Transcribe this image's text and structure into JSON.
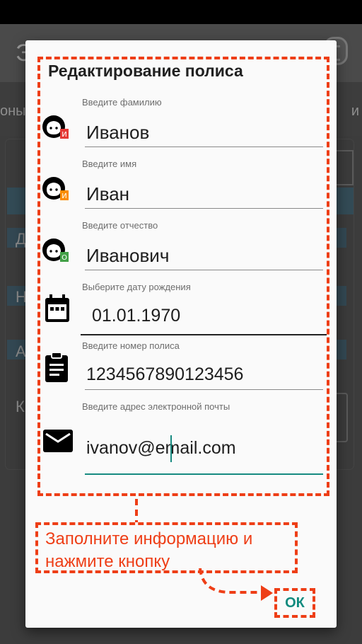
{
  "background": {
    "app_title": "Э",
    "tab_left": "оны",
    "tab_right": "и",
    "row_letters": [
      "Д",
      "Н",
      "А",
      "К"
    ]
  },
  "dialog": {
    "title": "Редактирование полиса",
    "fields": {
      "surname": {
        "label": "Введите фамилию",
        "value": "Иванов",
        "icon": "person-surname-icon",
        "badge_letter": "И",
        "badge_color": "#e53935"
      },
      "name": {
        "label": "Введите имя",
        "value": "Иван",
        "icon": "person-name-icon",
        "badge_letter": "И",
        "badge_color": "#fb8c00"
      },
      "patronymic": {
        "label": "Введите отчество",
        "value": "Иванович",
        "icon": "person-patronymic-icon",
        "badge_letter": "О",
        "badge_color": "#43a047"
      },
      "birthdate": {
        "label": "Выберите дату рождения",
        "value": "01.01.1970",
        "icon": "calendar-icon"
      },
      "policy_number": {
        "label": "Введите номер полиса",
        "value": "1234567890123456",
        "icon": "clipboard-icon"
      },
      "email": {
        "label": "Введите адрес электронной почты",
        "value": "ivanov@email.com",
        "icon": "envelope-icon"
      }
    },
    "ok_label": "ОК"
  },
  "annotation": {
    "callout_text": "Заполните информацию и\nнажмите кнопку",
    "accent_color": "#ee3e16"
  },
  "colors": {
    "accent": "#178a80",
    "annotation": "#ee3e16"
  }
}
